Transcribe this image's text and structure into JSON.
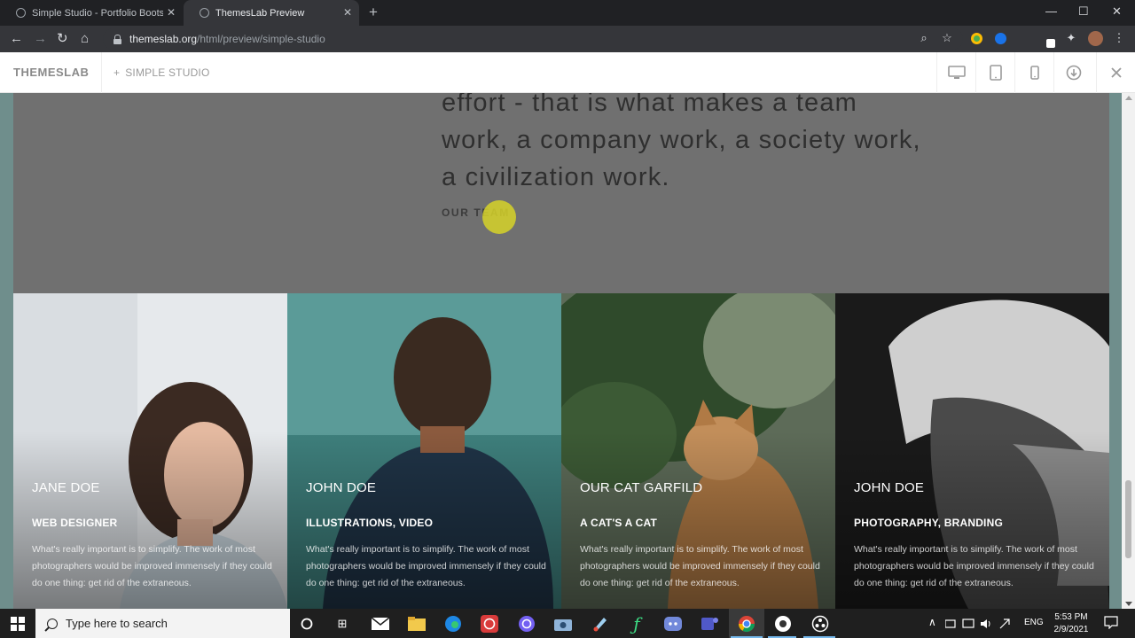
{
  "browser": {
    "tabs": [
      {
        "title": "Simple Studio - Portfolio Bootstr",
        "active": false
      },
      {
        "title": "ThemesLab Preview",
        "active": true
      }
    ],
    "new_tab": "+",
    "window": {
      "minimize": "—",
      "maximize": "☐",
      "close": "✕"
    },
    "close_glyph": "✕",
    "nav": {
      "back": "←",
      "forward": "→",
      "reload": "↻",
      "home": "⌂"
    },
    "url": {
      "host": "themeslab.org",
      "path": "/html/preview/simple-studio"
    },
    "toolbar_icons": {
      "zoom": "⌕",
      "bookmark": "☆",
      "puzzle": "✦",
      "menu": "⋮"
    }
  },
  "preview_header": {
    "brand": "THEMESLAB",
    "crumb_plus": "+",
    "crumb": "SIMPLE STUDIO",
    "devices": [
      "desktop-icon",
      "tablet-icon",
      "mobile-icon",
      "download-icon",
      "close-icon"
    ]
  },
  "page": {
    "quote_lines": [
      "effort - that is what makes a team",
      "work, a company work, a society work,",
      "a civilization work."
    ],
    "quote_link": "OUR TEAM",
    "team": [
      {
        "name": "JANE DOE",
        "role": "WEB DESIGNER",
        "bio": "What's really important is to simplify. The work of most photographers would be improved immensely if they could do one thing: get rid of the extraneous."
      },
      {
        "name": "JOHN DOE",
        "role": "ILLUSTRATIONS, VIDEO",
        "bio": "What's really important is to simplify. The work of most photographers would be improved immensely if they could do one thing: get rid of the extraneous."
      },
      {
        "name": "OUR CAT GARFILD",
        "role": "A CAT'S A CAT",
        "bio": "What's really important is to simplify. The work of most photographers would be improved immensely if they could do one thing: get rid of the extraneous."
      },
      {
        "name": "JOHN DOE",
        "role": "PHOTOGRAPHY, BRANDING",
        "bio": "What's really important is to simplify. The work of most photographers would be improved immensely if they could do one thing: get rid of the extraneous."
      }
    ]
  },
  "taskbar": {
    "search_placeholder": "Type here to search",
    "apps": [
      "cortana-icon",
      "task-view-icon",
      "mail-icon",
      "file-explorer-icon",
      "edge-icon",
      "whatsapp-icon",
      "viber-icon",
      "camera-icon",
      "paint-icon",
      "function-icon",
      "discord-icon",
      "teams-icon",
      "chrome-icon",
      "media-icon",
      "obs-icon"
    ],
    "task_view_glyph": "⊞",
    "function_glyph": "ƒ",
    "tray_up": "∧",
    "language": "ENG",
    "time": "5:53 PM",
    "date": "2/9/2021"
  },
  "colors": {
    "accent_click": "#d6d228",
    "page_teal": "#6f8e8c",
    "chrome_bg": "#202124",
    "chrome_toolbar": "#35363a"
  }
}
